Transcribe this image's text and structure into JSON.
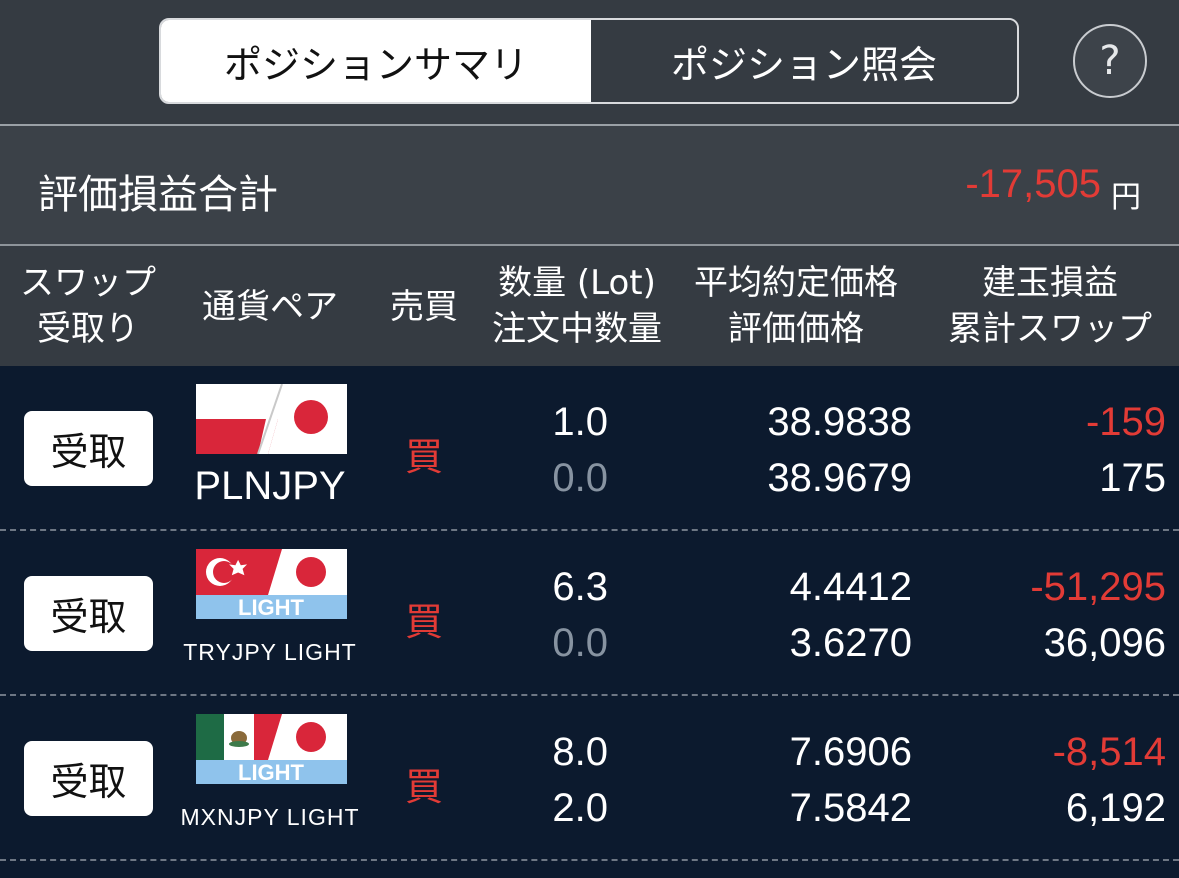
{
  "tabs": [
    {
      "label": "ポジションサマリ",
      "active": true
    },
    {
      "label": "ポジション照会",
      "active": false
    }
  ],
  "help_label": "?",
  "summary": {
    "label": "評価損益合計",
    "value": "-17,505",
    "unit": "円"
  },
  "headers": {
    "swap_receive": [
      "スワップ",
      "受取り"
    ],
    "pair": "通貨ペア",
    "side": "売買",
    "qty": [
      "数量 (Lot)",
      "注文中数量"
    ],
    "price": [
      "平均約定価格",
      "評価価格"
    ],
    "pl": [
      "建玉損益",
      "累計スワップ"
    ]
  },
  "colors": {
    "negative": "#e23b36",
    "row_bg": "#0c1a2e",
    "header_bg": "#353b42"
  },
  "rows": [
    {
      "button": "受取",
      "pair": "PLNJPY",
      "flag_icon": "poland-japan-flag-icon",
      "side": "買",
      "qty": "1.0",
      "pending_qty": "0.0",
      "avg_price": "38.9838",
      "eval_price": "38.9679",
      "pl": "-159",
      "swap": "175"
    },
    {
      "button": "受取",
      "pair": "TRYJPY LIGHT",
      "flag_icon": "turkey-japan-light-flag-icon",
      "flag_badge": "LIGHT",
      "side": "買",
      "qty": "6.3",
      "pending_qty": "0.0",
      "avg_price": "4.4412",
      "eval_price": "3.6270",
      "pl": "-51,295",
      "swap": "36,096"
    },
    {
      "button": "受取",
      "pair": "MXNJPY LIGHT",
      "flag_icon": "mexico-japan-light-flag-icon",
      "flag_badge": "LIGHT",
      "side": "買",
      "qty": "8.0",
      "pending_qty": "2.0",
      "avg_price": "7.6906",
      "eval_price": "7.5842",
      "pl": "-8,514",
      "swap": "6,192"
    }
  ]
}
